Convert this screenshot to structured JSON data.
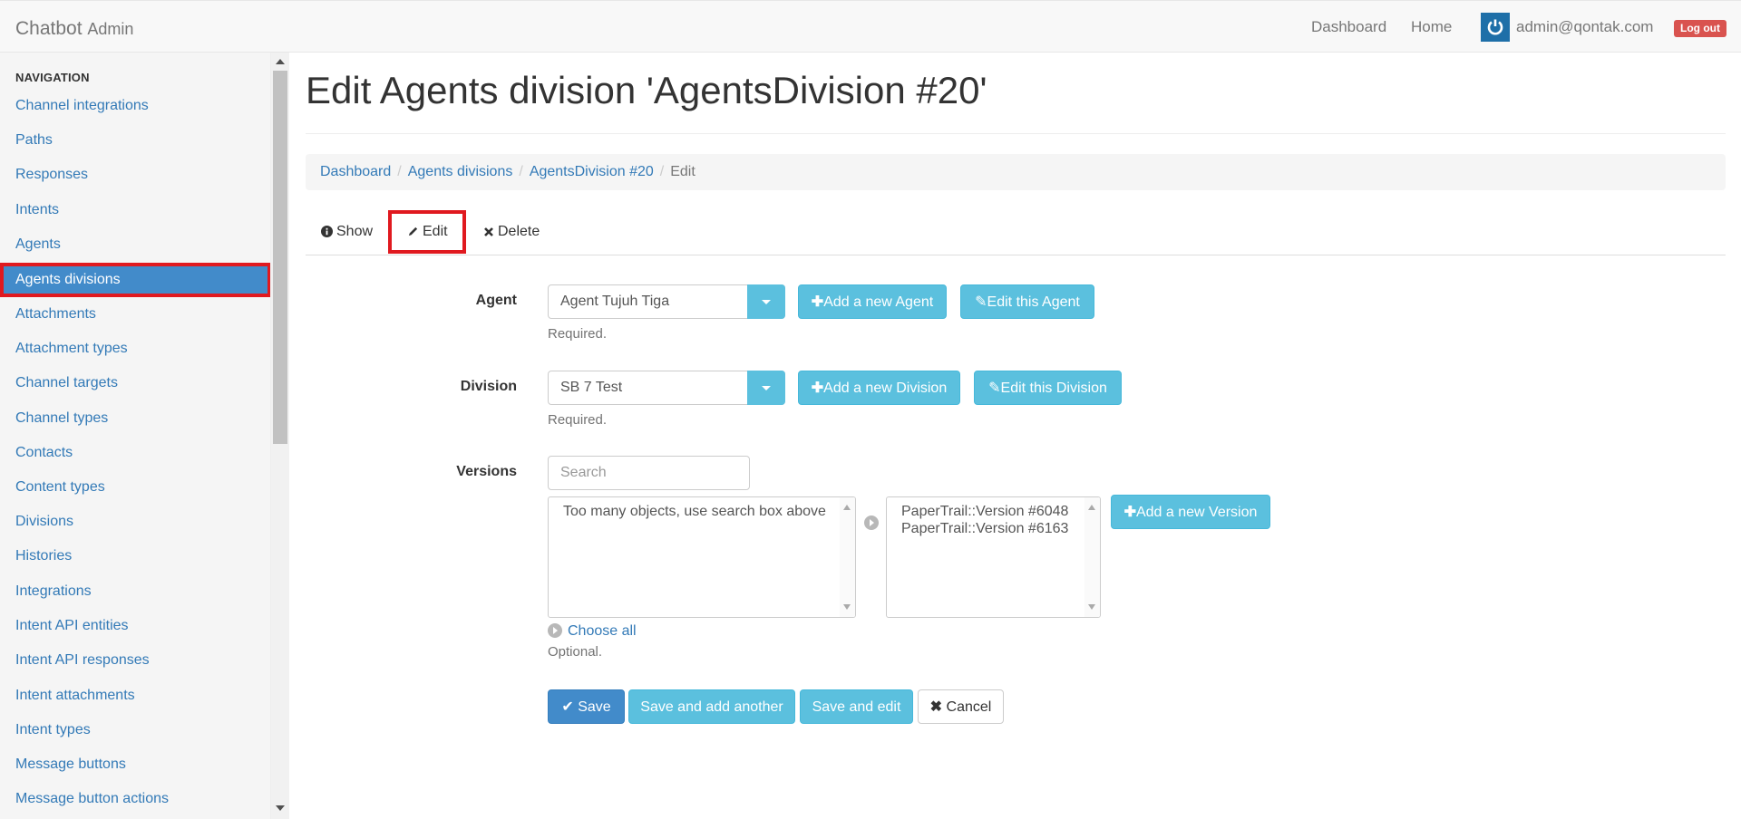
{
  "navbar": {
    "brand": "Chatbot",
    "brand_sub": "Admin",
    "links": [
      "Dashboard",
      "Home"
    ],
    "user_email": "admin@qontak.com",
    "logout_label": "Log out"
  },
  "sidebar": {
    "header": "NAVIGATION",
    "items": [
      {
        "label": "Channel integrations"
      },
      {
        "label": "Paths"
      },
      {
        "label": "Responses"
      },
      {
        "label": "Intents"
      },
      {
        "label": "Agents"
      },
      {
        "label": "Agents divisions",
        "active": true
      },
      {
        "label": "Attachments"
      },
      {
        "label": "Attachment types"
      },
      {
        "label": "Channel targets"
      },
      {
        "label": "Channel types"
      },
      {
        "label": "Contacts"
      },
      {
        "label": "Content types"
      },
      {
        "label": "Divisions"
      },
      {
        "label": "Histories"
      },
      {
        "label": "Integrations"
      },
      {
        "label": "Intent API entities"
      },
      {
        "label": "Intent API responses"
      },
      {
        "label": "Intent attachments"
      },
      {
        "label": "Intent types"
      },
      {
        "label": "Message buttons"
      },
      {
        "label": "Message button actions"
      }
    ]
  },
  "page": {
    "title": "Edit Agents division 'AgentsDivision #20'"
  },
  "breadcrumb": [
    "Dashboard",
    "Agents divisions",
    "AgentsDivision #20",
    "Edit"
  ],
  "tabs": {
    "show": "Show",
    "edit": "Edit",
    "delete": "Delete"
  },
  "form": {
    "agent": {
      "label": "Agent",
      "value": "Agent Tujuh Tiga",
      "add_label": "Add a new Agent",
      "edit_label": "Edit this Agent",
      "help": "Required."
    },
    "division": {
      "label": "Division",
      "value": "SB 7 Test",
      "add_label": "Add a new Division",
      "edit_label": "Edit this Division",
      "help": "Required."
    },
    "versions": {
      "label": "Versions",
      "search_placeholder": "Search",
      "available_message": "Too many objects, use search box above",
      "chosen": [
        "PaperTrail::Version #6048",
        "PaperTrail::Version #6163"
      ],
      "add_label": "Add a new Version",
      "choose_all": "Choose all",
      "help": "Optional."
    },
    "actions": {
      "save": "Save",
      "save_add": "Save and add another",
      "save_edit": "Save and edit",
      "cancel": "Cancel"
    }
  },
  "colors": {
    "primary": "#428bca",
    "info": "#5bc0de",
    "danger": "#d9534f",
    "highlight": "#e0191f"
  }
}
